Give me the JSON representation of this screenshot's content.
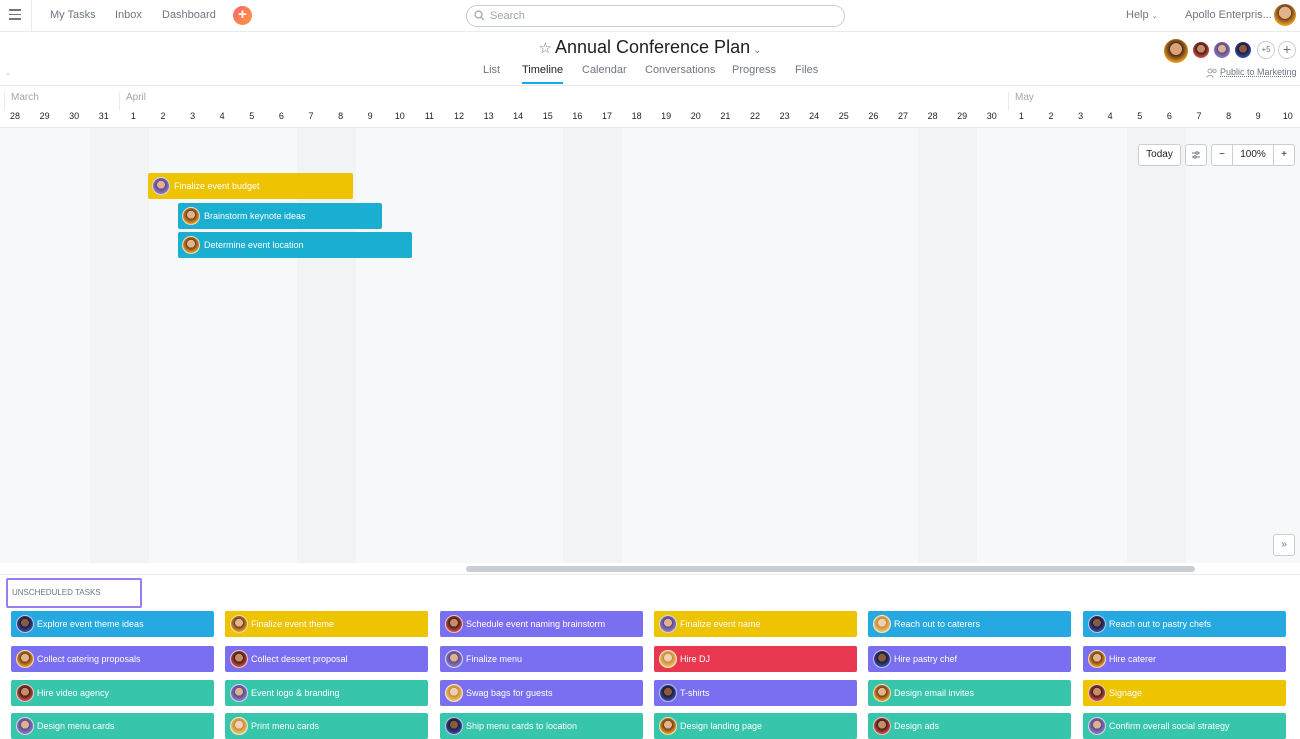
{
  "topbar": {
    "nav": [
      "My Tasks",
      "Inbox",
      "Dashboard"
    ],
    "search_placeholder": "Search",
    "help": "Help",
    "org": "Apollo Enterpris..."
  },
  "project": {
    "title": "Annual Conference Plan",
    "tabs": [
      "List",
      "Timeline",
      "Calendar",
      "Conversations",
      "Progress",
      "Files"
    ],
    "active_tab": "Timeline",
    "members_more": "+5",
    "visibility": "Public to Marketing"
  },
  "timeline": {
    "months": [
      "March",
      "April",
      "May"
    ],
    "days": [
      "28",
      "29",
      "30",
      "31",
      "1",
      "2",
      "3",
      "4",
      "5",
      "6",
      "7",
      "8",
      "9",
      "10",
      "11",
      "12",
      "13",
      "14",
      "15",
      "16",
      "17",
      "18",
      "19",
      "20",
      "21",
      "22",
      "23",
      "24",
      "25",
      "26",
      "27",
      "28",
      "29",
      "30",
      "1",
      "2",
      "3",
      "4",
      "5",
      "6",
      "7",
      "8",
      "9",
      "10"
    ],
    "controls": {
      "today": "Today",
      "zoom": "100%",
      "minus": "−",
      "plus": "+"
    },
    "tasks": [
      {
        "name": "Finalize event budget",
        "color": "#eec300",
        "start": "April 2",
        "end": "April 8"
      },
      {
        "name": "Brainstorm keynote ideas",
        "color": "#1aafd0",
        "start": "April 3",
        "end": "April 9"
      },
      {
        "name": "Determine event location",
        "color": "#1aafd0",
        "start": "April 3",
        "end": "April 10"
      }
    ]
  },
  "unscheduled": {
    "label": "UNSCHEDULED TASKS",
    "rows": [
      [
        {
          "name": "Explore event theme ideas",
          "color": "#25a9e0"
        },
        {
          "name": "Finalize event theme",
          "color": "#eec300"
        },
        {
          "name": "Schedule event naming brainstorm",
          "color": "#7a6ff0"
        },
        {
          "name": "Finalize event name",
          "color": "#eec300"
        },
        {
          "name": "Reach out to caterers",
          "color": "#25a9e0"
        },
        {
          "name": "Reach out to pastry chefs",
          "color": "#25a9e0"
        }
      ],
      [
        {
          "name": "Collect catering proposals",
          "color": "#7a6ff0"
        },
        {
          "name": "Collect dessert proposal",
          "color": "#7a6ff0"
        },
        {
          "name": "Finalize menu",
          "color": "#7a6ff0"
        },
        {
          "name": "Hire DJ",
          "color": "#e8384f"
        },
        {
          "name": "Hire pastry chef",
          "color": "#7a6ff0"
        },
        {
          "name": "Hire caterer",
          "color": "#7a6ff0"
        }
      ],
      [
        {
          "name": "Hire video agency",
          "color": "#37c5ab"
        },
        {
          "name": "Event logo & branding",
          "color": "#37c5ab"
        },
        {
          "name": "Swag bags for guests",
          "color": "#7a6ff0"
        },
        {
          "name": "T-shirts",
          "color": "#7a6ff0"
        },
        {
          "name": "Design email invites",
          "color": "#37c5ab"
        },
        {
          "name": "Signage",
          "color": "#eec300"
        }
      ],
      [
        {
          "name": "Design menu cards",
          "color": "#37c5ab"
        },
        {
          "name": "Print menu cards",
          "color": "#37c5ab"
        },
        {
          "name": "Ship menu cards to location",
          "color": "#37c5ab"
        },
        {
          "name": "Design landing page",
          "color": "#37c5ab"
        },
        {
          "name": "Design ads",
          "color": "#37c5ab"
        },
        {
          "name": "Confirm overall social strategy",
          "color": "#37c5ab"
        }
      ]
    ]
  }
}
